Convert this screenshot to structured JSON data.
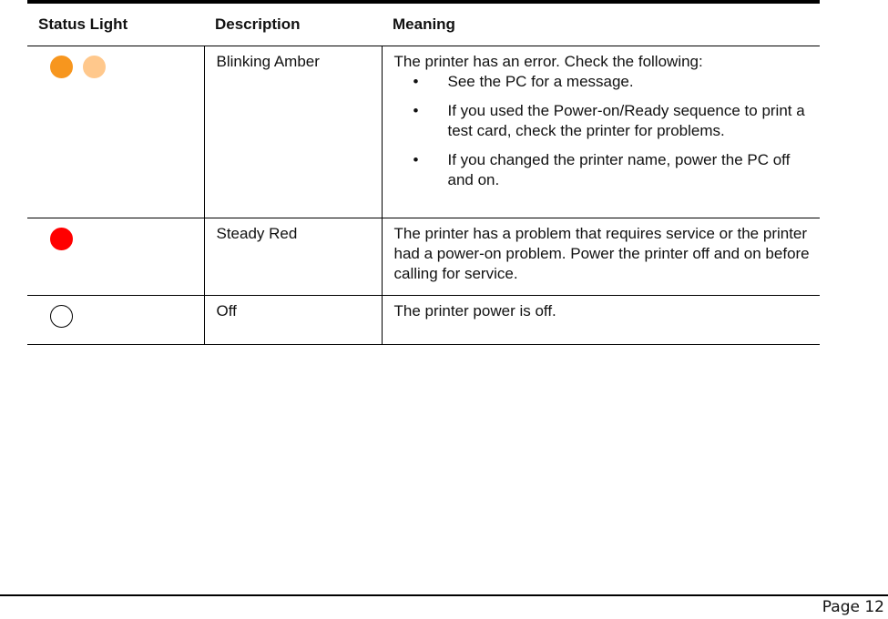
{
  "table": {
    "headers": [
      "Status Light",
      "Description",
      "Meaning"
    ],
    "rows": [
      {
        "lights": [
          {
            "icon": "amber-light-on-icon",
            "fill": "#F7961E",
            "border": "#F7961E"
          },
          {
            "icon": "amber-light-dim-icon",
            "fill": "#FFC88C",
            "border": "#FFC88C"
          }
        ],
        "description": "Blinking Amber",
        "meaning": "The printer has an error. Check the following:",
        "bullets": [
          "See the PC for a message.",
          "If you used the Power-on/Ready sequence to print a test card, check the printer for problems.",
          "If you changed the printer name, power the PC off and on."
        ]
      },
      {
        "lights": [
          {
            "icon": "red-light-icon",
            "fill": "#FF0000",
            "border": "#FF0000"
          }
        ],
        "description": "Steady Red",
        "meaning": "The printer has a problem that requires service or the printer had a power-on problem. Power the printer off and on before calling for service."
      },
      {
        "lights": [
          {
            "icon": "light-off-icon",
            "fill": "#FFFFFF",
            "border": "#000000"
          }
        ],
        "description": "Off",
        "meaning": "The printer power is off."
      }
    ]
  },
  "footer": {
    "page_label": "Page 12"
  }
}
